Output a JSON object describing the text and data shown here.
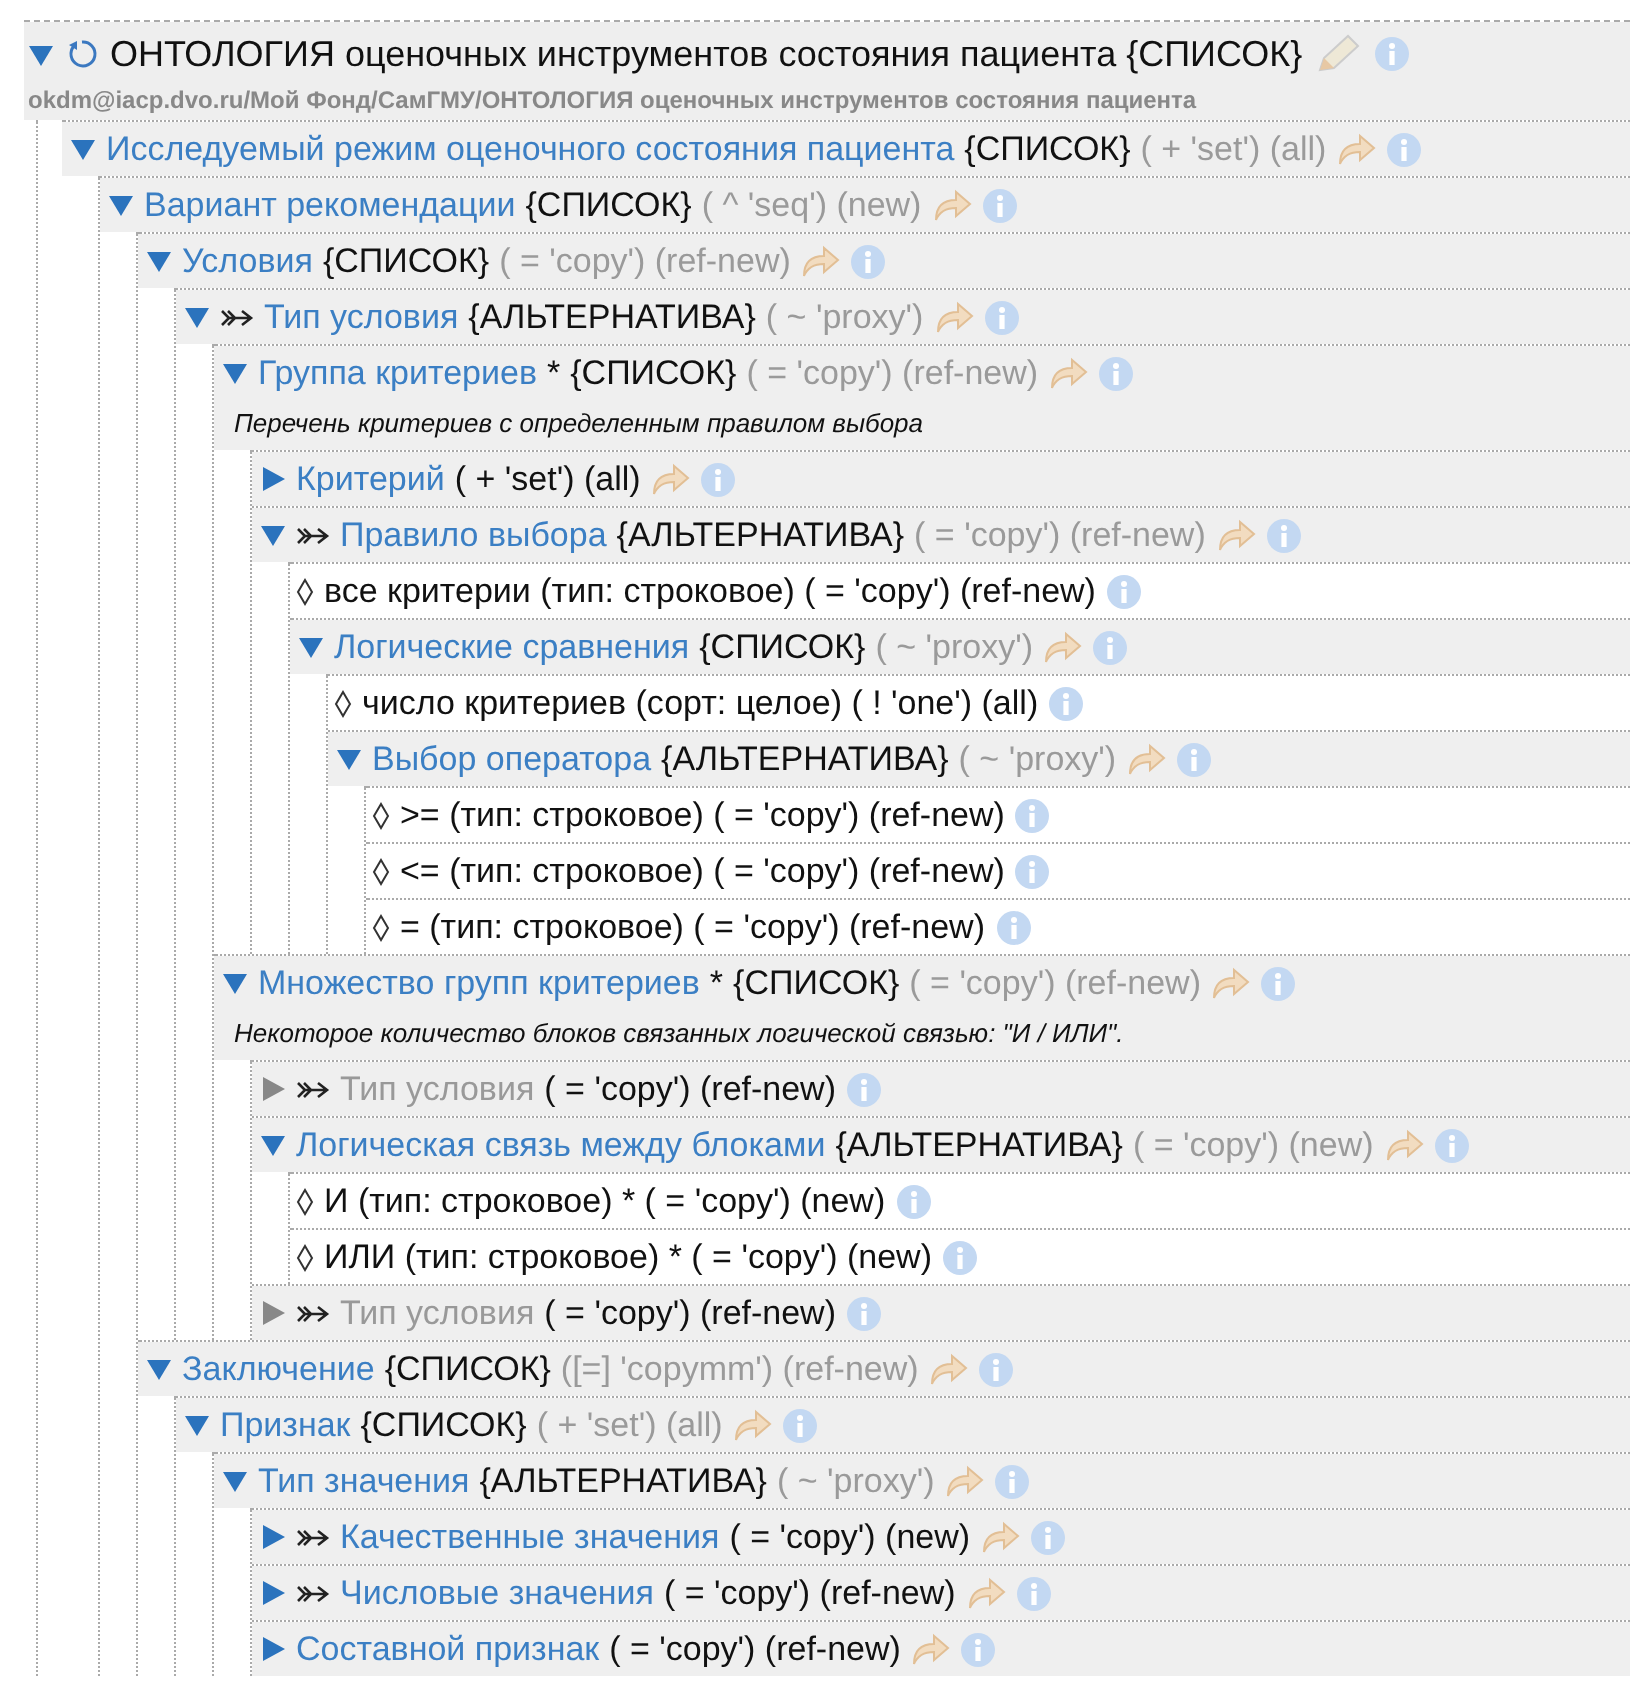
{
  "header": {
    "title": "ОНТОЛОГИЯ оценочных инструментов состояния пациента {СПИСОК}",
    "expanded": true,
    "path": "okdm@iacp.dvo.ru/Мой Фонд/СамГМУ/ОНТОЛОГИЯ оценочных инструментов состояния пациента"
  },
  "tree": [
    {
      "kind": "concept",
      "name": "Исследуемый режим оценочного состояния пациента",
      "alternative": false,
      "expanded": true,
      "disabled": false,
      "type": "{СПИСОК}",
      "meta": "( + 'set') (all)",
      "meta_dim": true,
      "children": [
        {
          "kind": "concept",
          "name": "Вариант рекомендации",
          "alternative": false,
          "expanded": true,
          "disabled": false,
          "type": "{СПИСОК}",
          "meta": "( ^ 'seq') (new)",
          "meta_dim": true,
          "children": [
            {
              "kind": "concept",
              "name": "Условия",
              "alternative": false,
              "expanded": true,
              "disabled": false,
              "type": "{СПИСОК}",
              "meta": "( = 'copy') (ref-new)",
              "meta_dim": true,
              "children": [
                {
                  "kind": "concept",
                  "name": "Тип условия",
                  "alternative": true,
                  "expanded": true,
                  "disabled": false,
                  "type": "{АЛЬТЕРНАТИВА}",
                  "meta": "( ~ 'proxy')",
                  "meta_dim": true,
                  "children": [
                    {
                      "kind": "concept",
                      "name": "Группа критериев",
                      "alternative": false,
                      "expanded": true,
                      "disabled": false,
                      "mark": "*",
                      "type": "{СПИСОК}",
                      "meta": "( = 'copy') (ref-new)",
                      "meta_dim": true,
                      "description": "Перечень критериев с определенным правилом выбора",
                      "children": [
                        {
                          "kind": "concept",
                          "name": "Критерий",
                          "alternative": false,
                          "expanded": false,
                          "disabled": false,
                          "meta": "( + 'set') (all)",
                          "meta_dim": false
                        },
                        {
                          "kind": "concept",
                          "name": "Правило выбора",
                          "alternative": true,
                          "expanded": true,
                          "disabled": false,
                          "type": "{АЛЬТЕРНАТИВА}",
                          "meta": "( = 'copy') (ref-new)",
                          "meta_dim": true,
                          "children": [
                            {
                              "kind": "value",
                              "text": "все критерии (тип: строковое) ( = 'copy') (ref-new)"
                            },
                            {
                              "kind": "concept",
                              "name": "Логические сравнения",
                              "alternative": false,
                              "expanded": true,
                              "disabled": false,
                              "type": "{СПИСОК}",
                              "meta": "( ~ 'proxy')",
                              "meta_dim": true,
                              "children": [
                                {
                                  "kind": "value",
                                  "text": "число критериев (сорт: целое) ( ! 'one') (all)"
                                },
                                {
                                  "kind": "concept",
                                  "name": "Выбор оператора",
                                  "alternative": false,
                                  "expanded": true,
                                  "disabled": false,
                                  "type": "{АЛЬТЕРНАТИВА}",
                                  "meta": "( ~ 'proxy')",
                                  "meta_dim": true,
                                  "children": [
                                    {
                                      "kind": "value",
                                      "text": ">= (тип: строковое) ( = 'copy') (ref-new)"
                                    },
                                    {
                                      "kind": "value",
                                      "text": "<= (тип: строковое) ( = 'copy') (ref-new)"
                                    },
                                    {
                                      "kind": "value",
                                      "text": "= (тип: строковое) ( = 'copy') (ref-new)"
                                    }
                                  ]
                                }
                              ]
                            }
                          ]
                        }
                      ]
                    },
                    {
                      "kind": "concept",
                      "name": "Множество групп критериев",
                      "alternative": false,
                      "expanded": true,
                      "disabled": false,
                      "mark": "*",
                      "type": "{СПИСОК}",
                      "meta": "( = 'copy') (ref-new)",
                      "meta_dim": true,
                      "description": "Некоторое количество блоков связанных логической связью: \"И / ИЛИ\".",
                      "children": [
                        {
                          "kind": "concept",
                          "name": "Тип условия",
                          "alternative": true,
                          "expanded": false,
                          "disabled": true,
                          "meta": "( = 'copy') (ref-new)",
                          "meta_dim": false
                        },
                        {
                          "kind": "concept",
                          "name": "Логическая связь между блоками",
                          "alternative": false,
                          "expanded": true,
                          "disabled": false,
                          "type": "{АЛЬТЕРНАТИВА}",
                          "meta": "( = 'copy') (new)",
                          "meta_dim": true,
                          "children": [
                            {
                              "kind": "value",
                              "text": "И (тип: строковое) * ( = 'copy') (new)"
                            },
                            {
                              "kind": "value",
                              "text": "ИЛИ (тип: строковое) * ( = 'copy') (new)"
                            }
                          ]
                        },
                        {
                          "kind": "concept",
                          "name": "Тип условия",
                          "alternative": true,
                          "expanded": false,
                          "disabled": true,
                          "meta": "( = 'copy') (ref-new)",
                          "meta_dim": false
                        }
                      ]
                    }
                  ]
                }
              ]
            },
            {
              "kind": "concept",
              "name": "Заключение",
              "alternative": false,
              "expanded": true,
              "disabled": false,
              "type": "{СПИСОК}",
              "meta": "([=] 'copymm') (ref-new)",
              "meta_dim": true,
              "children": [
                {
                  "kind": "concept",
                  "name": "Признак",
                  "alternative": false,
                  "expanded": true,
                  "disabled": false,
                  "type": "{СПИСОК}",
                  "meta": "( + 'set') (all)",
                  "meta_dim": true,
                  "children": [
                    {
                      "kind": "concept",
                      "name": "Тип значения",
                      "alternative": false,
                      "expanded": true,
                      "disabled": false,
                      "type": "{АЛЬТЕРНАТИВА}",
                      "meta": "( ~ 'proxy')",
                      "meta_dim": true,
                      "children": [
                        {
                          "kind": "concept",
                          "name": "Качественные значения",
                          "alternative": true,
                          "expanded": false,
                          "disabled": false,
                          "meta": "( = 'copy') (new)",
                          "meta_dim": false
                        },
                        {
                          "kind": "concept",
                          "name": "Числовые значения",
                          "alternative": true,
                          "expanded": false,
                          "disabled": false,
                          "meta": "( = 'copy') (ref-new)",
                          "meta_dim": false
                        },
                        {
                          "kind": "concept",
                          "name": "Составной признак",
                          "alternative": false,
                          "expanded": false,
                          "disabled": false,
                          "meta": "( = 'copy') (ref-new)",
                          "meta_dim": false
                        }
                      ]
                    }
                  ]
                }
              ]
            }
          ]
        }
      ]
    }
  ]
}
